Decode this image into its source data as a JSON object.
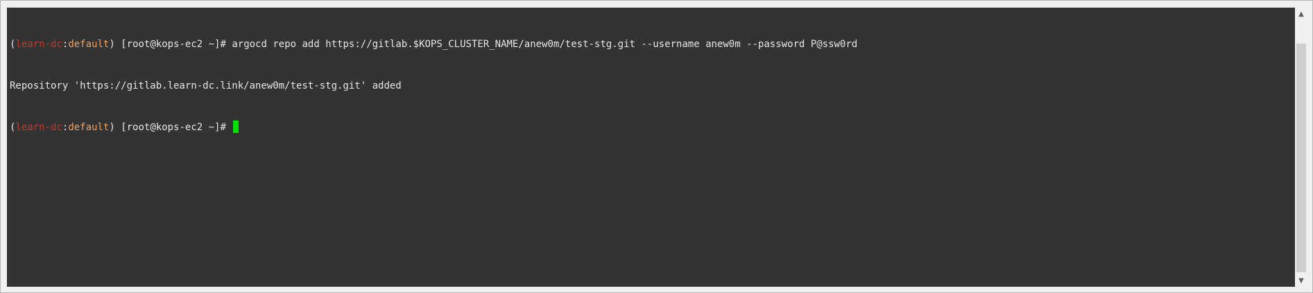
{
  "terminal": {
    "lines": [
      {
        "open_paren": "(",
        "context": "learn-dc",
        "colon": ":",
        "namespace": "default",
        "close_and_prompt": ") [root@kops-ec2 ~]# ",
        "command": "argocd repo add https://gitlab.$KOPS_CLUSTER_NAME/anew0m/test-stg.git --username anew0m --password P@ssw0rd"
      },
      {
        "output": "Repository 'https://gitlab.learn-dc.link/anew0m/test-stg.git' added"
      },
      {
        "open_paren": "(",
        "context": "learn-dc",
        "colon": ":",
        "namespace": "default",
        "close_and_prompt": ") [root@kops-ec2 ~]# ",
        "command": ""
      }
    ]
  },
  "scrollbar": {
    "up_icon": "▲",
    "down_icon": "▼"
  },
  "colors": {
    "background": "#333333",
    "text": "#e6e6e6",
    "context": "#c0392b",
    "namespace": "#e8a36a",
    "cursor": "#00e000"
  }
}
